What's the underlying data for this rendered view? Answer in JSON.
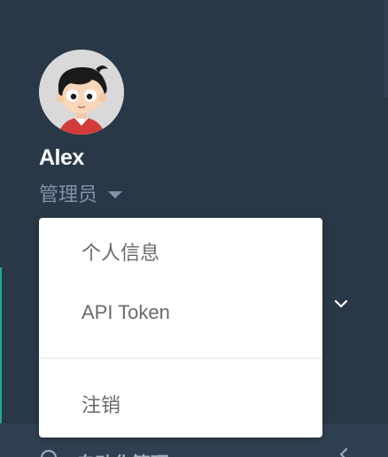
{
  "user": {
    "name": "Alex",
    "role": "管理员"
  },
  "dropdown": {
    "items": [
      {
        "label": "个人信息"
      },
      {
        "label": "API Token"
      },
      {
        "label": "注销"
      }
    ]
  },
  "nav": {
    "bottom_item_label": "自动化管理",
    "bottom_item_icon": "circle-icon",
    "chevron_icon": "chevron-down-icon"
  },
  "colors": {
    "sidebar_bg": "#293846",
    "nav_bg": "#2f4050",
    "accent": "#19aa8d",
    "menu_text": "#676a6c"
  }
}
